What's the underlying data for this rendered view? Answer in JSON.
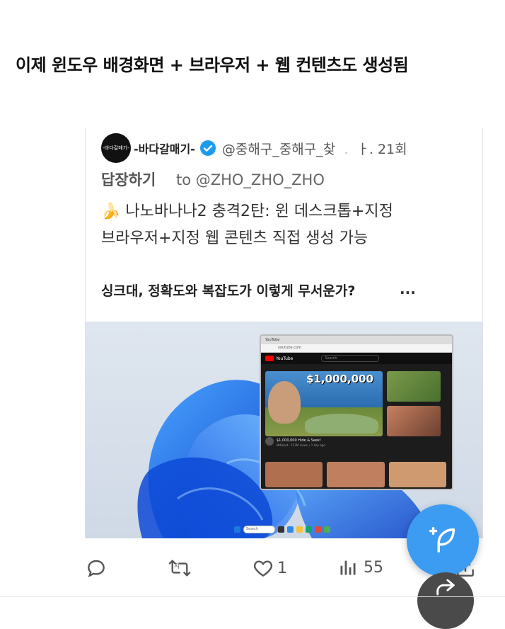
{
  "headline": "이제 윈도우 배경화면 + 브라우저 + 웹 컨텐츠도 생성됨",
  "tweet": {
    "avatar_text": "-바다갈매기-",
    "author_name": "-바다갈매기-",
    "handle_partial": "@중해구_중해구_찾",
    "handle_tail": "ㅏ. 21회",
    "reply_label": "답장하기",
    "reply_to": "to @ZHO_ZHO_ZHO",
    "line1": "🍌 나노바나나2 충격2탄: 윈 데스크톱+지정",
    "line2": "브라우저+지정 웹 콘텐츠 직접 생성 가능",
    "line3": "싱크대, 정확도와 복잡도가 이렇게 무서운가?",
    "more": "..."
  },
  "browser": {
    "tab_title": "YouTube",
    "url": "youtube.com",
    "logo_text": "YouTube",
    "search_placeholder": "Search",
    "thumbnail_text": "$1,000,000",
    "video_title": "$1,000,000 Hide & Seek!",
    "video_channel": "MrBeast",
    "video_meta": "123M views • 1 day ago"
  },
  "taskbar": {
    "search_label": "Search"
  },
  "actions": {
    "retweet_badge": "지",
    "like_count": "1",
    "views_count": "55"
  },
  "colors": {
    "accent": "#3b9cf2",
    "verified": "#1d9bf0",
    "text_dark": "#111111",
    "muted": "#555555"
  },
  "icons": [
    "reply-icon",
    "retweet-icon",
    "heart-icon",
    "views-icon",
    "share-icon",
    "verified-icon",
    "compose-icon",
    "forward-icon"
  ]
}
